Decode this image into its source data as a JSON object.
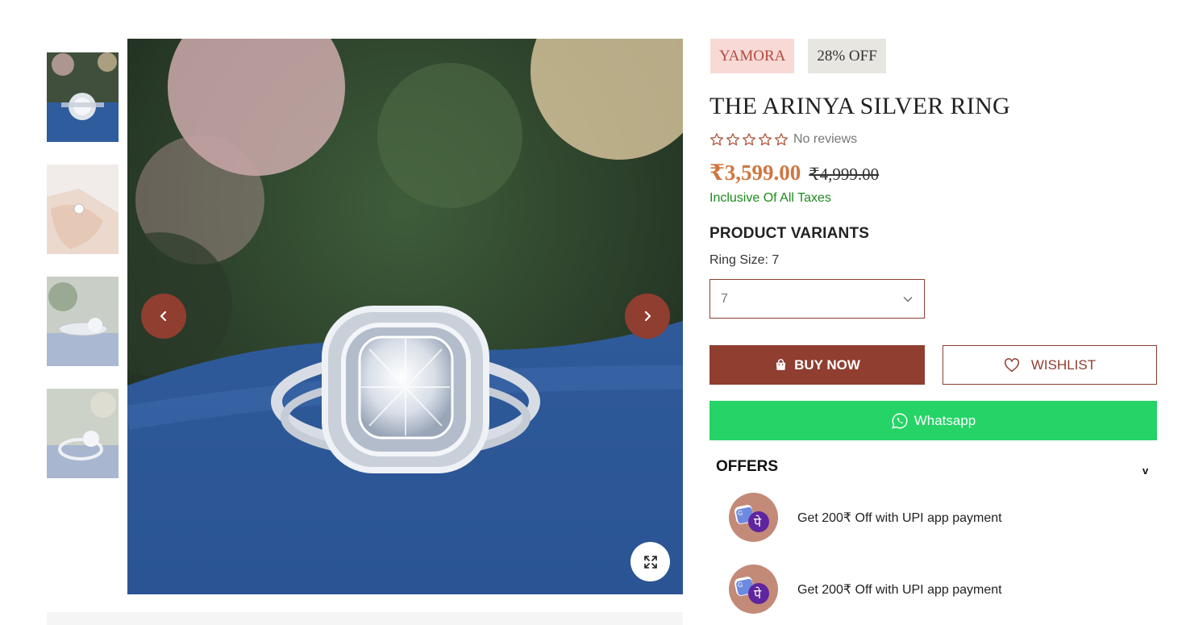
{
  "gallery": {
    "thumbnails": [
      {
        "alt": "Ring top view on blue cloth"
      },
      {
        "alt": "Ring worn on hand"
      },
      {
        "alt": "Ring side view"
      },
      {
        "alt": "Ring angled view"
      }
    ],
    "prev_icon": "chevron-left-icon",
    "next_icon": "chevron-right-icon",
    "zoom_icon": "expand-icon"
  },
  "product": {
    "brand": "YAMORA",
    "discount": "28% OFF",
    "title": "THE ARINYA SILVER RING",
    "rating": 0,
    "rating_text": "No reviews",
    "price": "₹3,599.00",
    "compare_price": "₹4,999.00",
    "tax_note": "Inclusive Of All Taxes"
  },
  "variants": {
    "heading": "PRODUCT VARIANTS",
    "size_label": "Ring Size: 7",
    "selected": "7"
  },
  "actions": {
    "buy_now": "BUY NOW",
    "wishlist": "WISHLIST",
    "whatsapp": "Whatsapp"
  },
  "offers": {
    "heading": "OFFERS",
    "toggle": "v",
    "items": [
      {
        "text": "Get 200₹ Off with UPI app payment"
      },
      {
        "text": "Get 200₹ Off with UPI app payment"
      }
    ]
  },
  "colors": {
    "accent": "#8f3e30",
    "price": "#d0763f",
    "whatsapp": "#25d366",
    "tax": "#1e8a1e"
  }
}
